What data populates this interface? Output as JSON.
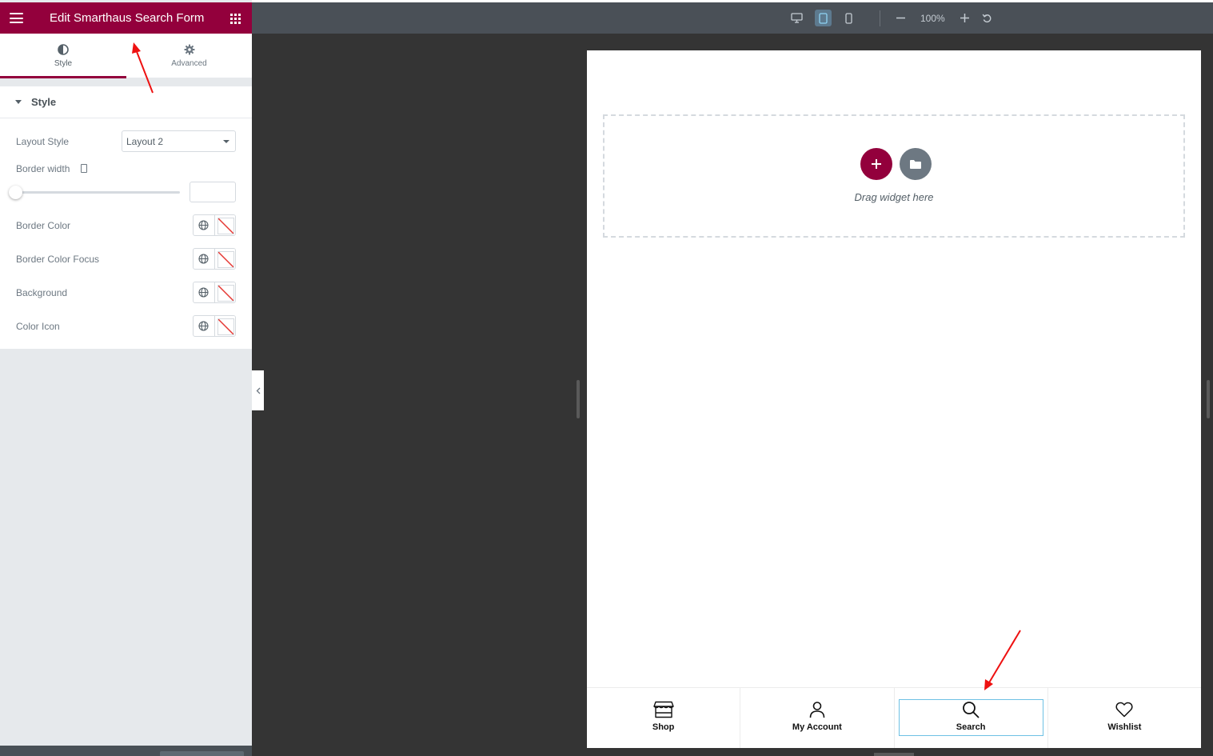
{
  "panel": {
    "title": "Edit Smarthaus Search Form",
    "tabs": [
      {
        "label": "Style",
        "icon": "contrast-icon",
        "active": true
      },
      {
        "label": "Advanced",
        "icon": "gear-icon",
        "active": false
      }
    ],
    "section_title": "Style",
    "controls": {
      "layout_style_label": "Layout Style",
      "layout_style_value": "Layout 2",
      "border_width_label": "Border width",
      "border_width_value": "",
      "border_color_label": "Border Color",
      "border_color_focus_label": "Border Color Focus",
      "background_label": "Background",
      "color_icon_label": "Color Icon"
    }
  },
  "toolbar": {
    "devices": [
      "desktop",
      "tablet",
      "mobile"
    ],
    "active_device": "tablet",
    "zoom": "100%"
  },
  "canvas": {
    "drag_text": "Drag widget here",
    "bottom_nav": [
      {
        "label": "Shop",
        "icon": "shop-icon"
      },
      {
        "label": "My Account",
        "icon": "user-icon"
      },
      {
        "label": "Search",
        "icon": "search-icon",
        "selected": true
      },
      {
        "label": "Wishlist",
        "icon": "heart-icon"
      }
    ]
  },
  "colors": {
    "brand": "#93003c",
    "toolbar": "#4a5057",
    "canvas": "#343434",
    "selection": "#6ec1e4",
    "annotation_arrow": "#ee1111"
  }
}
